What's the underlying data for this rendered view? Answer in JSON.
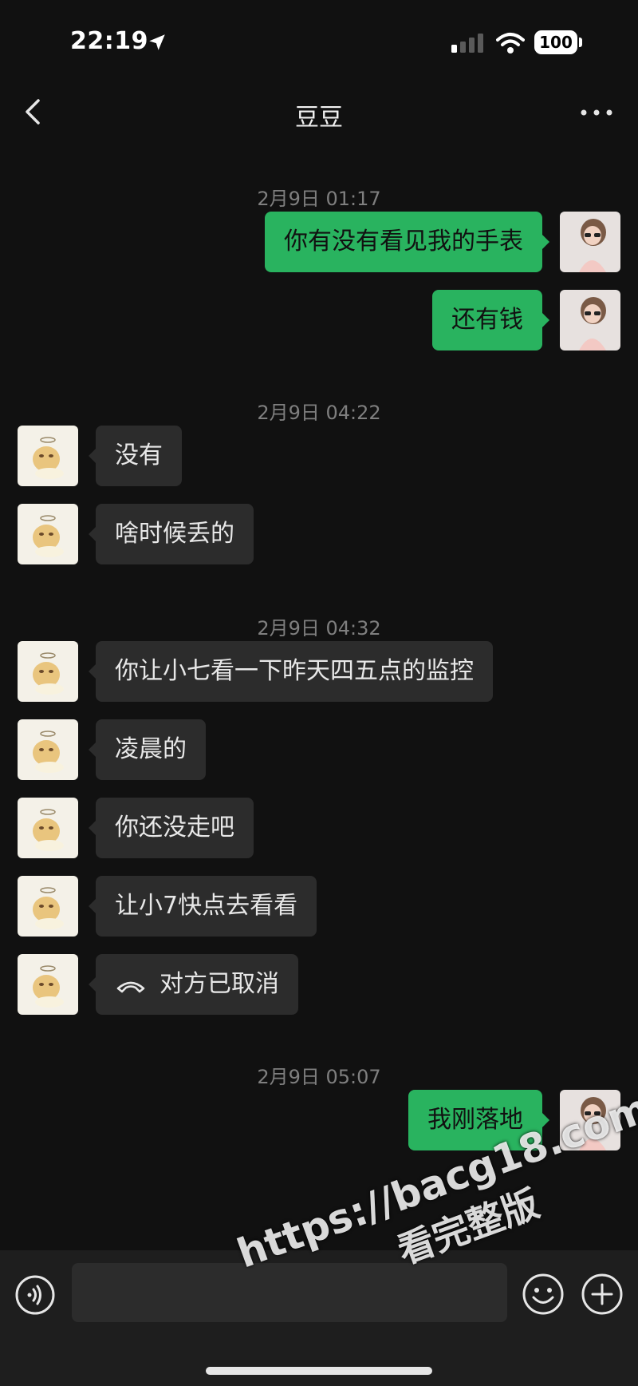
{
  "status_bar": {
    "time": "22:19",
    "battery": "100"
  },
  "header": {
    "title": "豆豆"
  },
  "messages": [
    {
      "type": "time",
      "text": "2月9日 01:17"
    },
    {
      "type": "msg",
      "side": "right",
      "text": "你有没有看见我的手表"
    },
    {
      "type": "msg",
      "side": "right",
      "text": "还有钱"
    },
    {
      "type": "time",
      "text": "2月9日 04:22"
    },
    {
      "type": "msg",
      "side": "left",
      "text": "没有"
    },
    {
      "type": "msg",
      "side": "left",
      "text": "啥时候丢的"
    },
    {
      "type": "time",
      "text": "2月9日 04:32"
    },
    {
      "type": "msg",
      "side": "left",
      "text": "你让小七看一下昨天四五点的监控"
    },
    {
      "type": "msg",
      "side": "left",
      "text": "凌晨的"
    },
    {
      "type": "msg",
      "side": "left",
      "text": "你还没走吧"
    },
    {
      "type": "msg",
      "side": "left",
      "text": "让小7快点去看看"
    },
    {
      "type": "call",
      "side": "left",
      "text": "对方已取消"
    },
    {
      "type": "time",
      "text": "2月9日 05:07"
    },
    {
      "type": "msg",
      "side": "right",
      "text": "我刚落地"
    }
  ],
  "input": {
    "value": ""
  },
  "watermark": {
    "line1": "https://bacg18.com",
    "line2": "看完整版"
  },
  "colors": {
    "background": "#111111",
    "bubble_self": "#29b35f",
    "bubble_other": "#2c2c2c",
    "timestamp": "#7f7f7f"
  }
}
